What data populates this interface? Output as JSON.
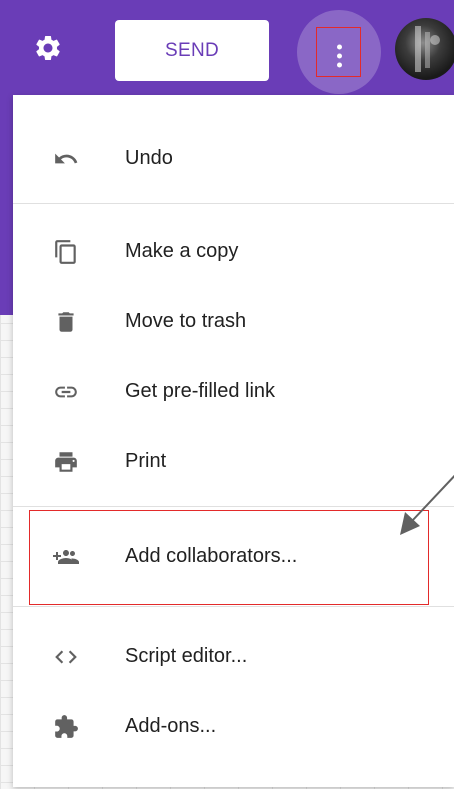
{
  "toolbar": {
    "send_label": "SEND",
    "colors": {
      "brand": "#6a3db7",
      "highlight": "#e32a2a"
    },
    "icons": [
      "gear-icon",
      "more-vert-icon"
    ]
  },
  "menu": {
    "items": [
      {
        "label": "Undo",
        "icon": "undo-icon"
      },
      {
        "label": "Make a copy",
        "icon": "copy-icon"
      },
      {
        "label": "Move to trash",
        "icon": "trash-icon"
      },
      {
        "label": "Get pre-filled link",
        "icon": "link-icon"
      },
      {
        "label": "Print",
        "icon": "print-icon"
      },
      {
        "label": "Add collaborators...",
        "icon": "add-people-icon"
      },
      {
        "label": "Script editor...",
        "icon": "code-icon"
      },
      {
        "label": "Add-ons...",
        "icon": "puzzle-icon"
      }
    ]
  }
}
